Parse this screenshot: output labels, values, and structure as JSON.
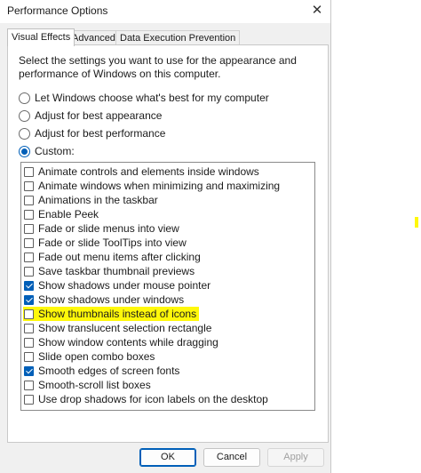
{
  "window": {
    "title": "Performance Options",
    "close_glyph": "✕"
  },
  "tabs": [
    {
      "label": "Visual Effects",
      "active": true
    },
    {
      "label": "Advanced",
      "active": false
    },
    {
      "label": "Data Execution Prevention",
      "active": false
    }
  ],
  "intro_text": "Select the settings you want to use for the appearance and performance of Windows on this computer.",
  "radios": [
    {
      "label": "Let Windows choose what's best for my computer",
      "checked": false
    },
    {
      "label": "Adjust for best appearance",
      "checked": false
    },
    {
      "label": "Adjust for best performance",
      "checked": false
    },
    {
      "label": "Custom:",
      "checked": true
    }
  ],
  "effects": [
    {
      "label": "Animate controls and elements inside windows",
      "checked": false
    },
    {
      "label": "Animate windows when minimizing and maximizing",
      "checked": false
    },
    {
      "label": "Animations in the taskbar",
      "checked": false
    },
    {
      "label": "Enable Peek",
      "checked": false
    },
    {
      "label": "Fade or slide menus into view",
      "checked": false
    },
    {
      "label": "Fade or slide ToolTips into view",
      "checked": false
    },
    {
      "label": "Fade out menu items after clicking",
      "checked": false
    },
    {
      "label": "Save taskbar thumbnail previews",
      "checked": false
    },
    {
      "label": "Show shadows under mouse pointer",
      "checked": true
    },
    {
      "label": "Show shadows under windows",
      "checked": true
    },
    {
      "label": "Show thumbnails instead of icons",
      "checked": false,
      "highlighted": true
    },
    {
      "label": "Show translucent selection rectangle",
      "checked": false
    },
    {
      "label": "Show window contents while dragging",
      "checked": false
    },
    {
      "label": "Slide open combo boxes",
      "checked": false
    },
    {
      "label": "Smooth edges of screen fonts",
      "checked": true
    },
    {
      "label": "Smooth-scroll list boxes",
      "checked": false
    },
    {
      "label": "Use drop shadows for icon labels on the desktop",
      "checked": false
    }
  ],
  "buttons": {
    "ok": "OK",
    "cancel": "Cancel",
    "apply": "Apply"
  },
  "colors": {
    "accent": "#005fb8",
    "highlight": "#fff80a"
  }
}
